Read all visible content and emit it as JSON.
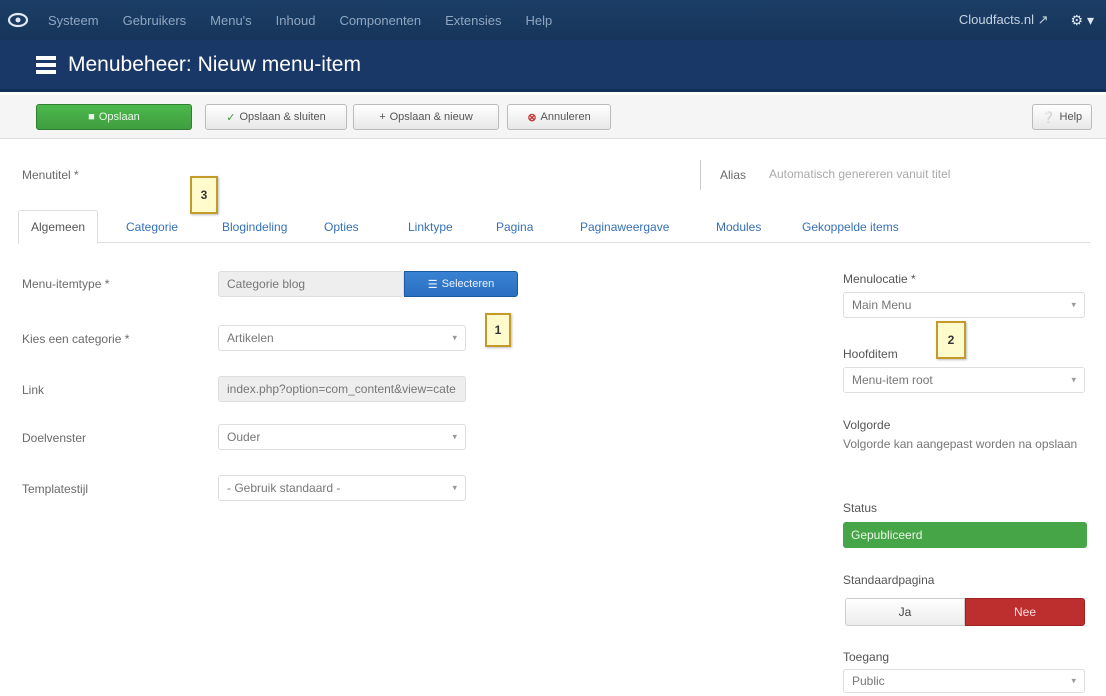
{
  "topnav": {
    "menu": [
      "Systeem",
      "Gebruikers",
      "Menu's",
      "Inhoud",
      "Componenten",
      "Extensies",
      "Help"
    ],
    "site_link": "Cloudfacts.nl ↗",
    "user_label": "⚙ ▾"
  },
  "header": {
    "title": "Menubeheer: Nieuw menu-item"
  },
  "toolbar": {
    "save": "Opslaan",
    "save_close": "Opslaan & sluiten",
    "save_new": "Opslaan & nieuw",
    "cancel": "Annuleren",
    "help": "Help"
  },
  "title_field": {
    "label": "Menutitel *",
    "value": ""
  },
  "alias_field": {
    "label": "Alias",
    "placeholder": "Automatisch genereren vanuit titel"
  },
  "tabs": [
    "Algemeen",
    "Categorie",
    "Blogindeling",
    "Opties",
    "Linktype",
    "Pagina",
    "Paginaweergave",
    "Modules",
    "Gekoppelde items"
  ],
  "form": {
    "menu_item_type": {
      "label": "Menu-itemtype *",
      "value": "Categorie blog",
      "button": "Selecteren"
    },
    "category": {
      "label": "Kies een categorie *",
      "value": "Artikelen"
    },
    "link": {
      "label": "Link",
      "value": "index.php?option=com_content&view=cate"
    },
    "target_window": {
      "label": "Doelvenster",
      "value": "Ouder"
    },
    "template_style": {
      "label": "Templatestijl",
      "value": "- Gebruik standaard -"
    }
  },
  "side": {
    "menu": {
      "label": "Menulocatie *",
      "value": "Main Menu"
    },
    "parent": {
      "label": "Hoofditem",
      "value": "Menu-item root"
    },
    "order": {
      "label": "Volgorde",
      "value": "Volgorde kan aangepast worden na opslaan"
    },
    "status": {
      "label": "Status",
      "value": "Gepubliceerd"
    },
    "default_page": {
      "label": "Standaardpagina",
      "yes": "Ja",
      "no": "Nee"
    },
    "access": {
      "label": "Toegang",
      "value": "Public"
    }
  },
  "callouts": [
    "1",
    "2",
    "3"
  ],
  "colors": {
    "nav": "#1b3e66",
    "header": "#1a3867",
    "green": "#46a546",
    "blue": "#2a6fc1",
    "red": "#bd2e2e",
    "callout_bg": "#fffbcc",
    "callout_border": "#c49a2a"
  }
}
